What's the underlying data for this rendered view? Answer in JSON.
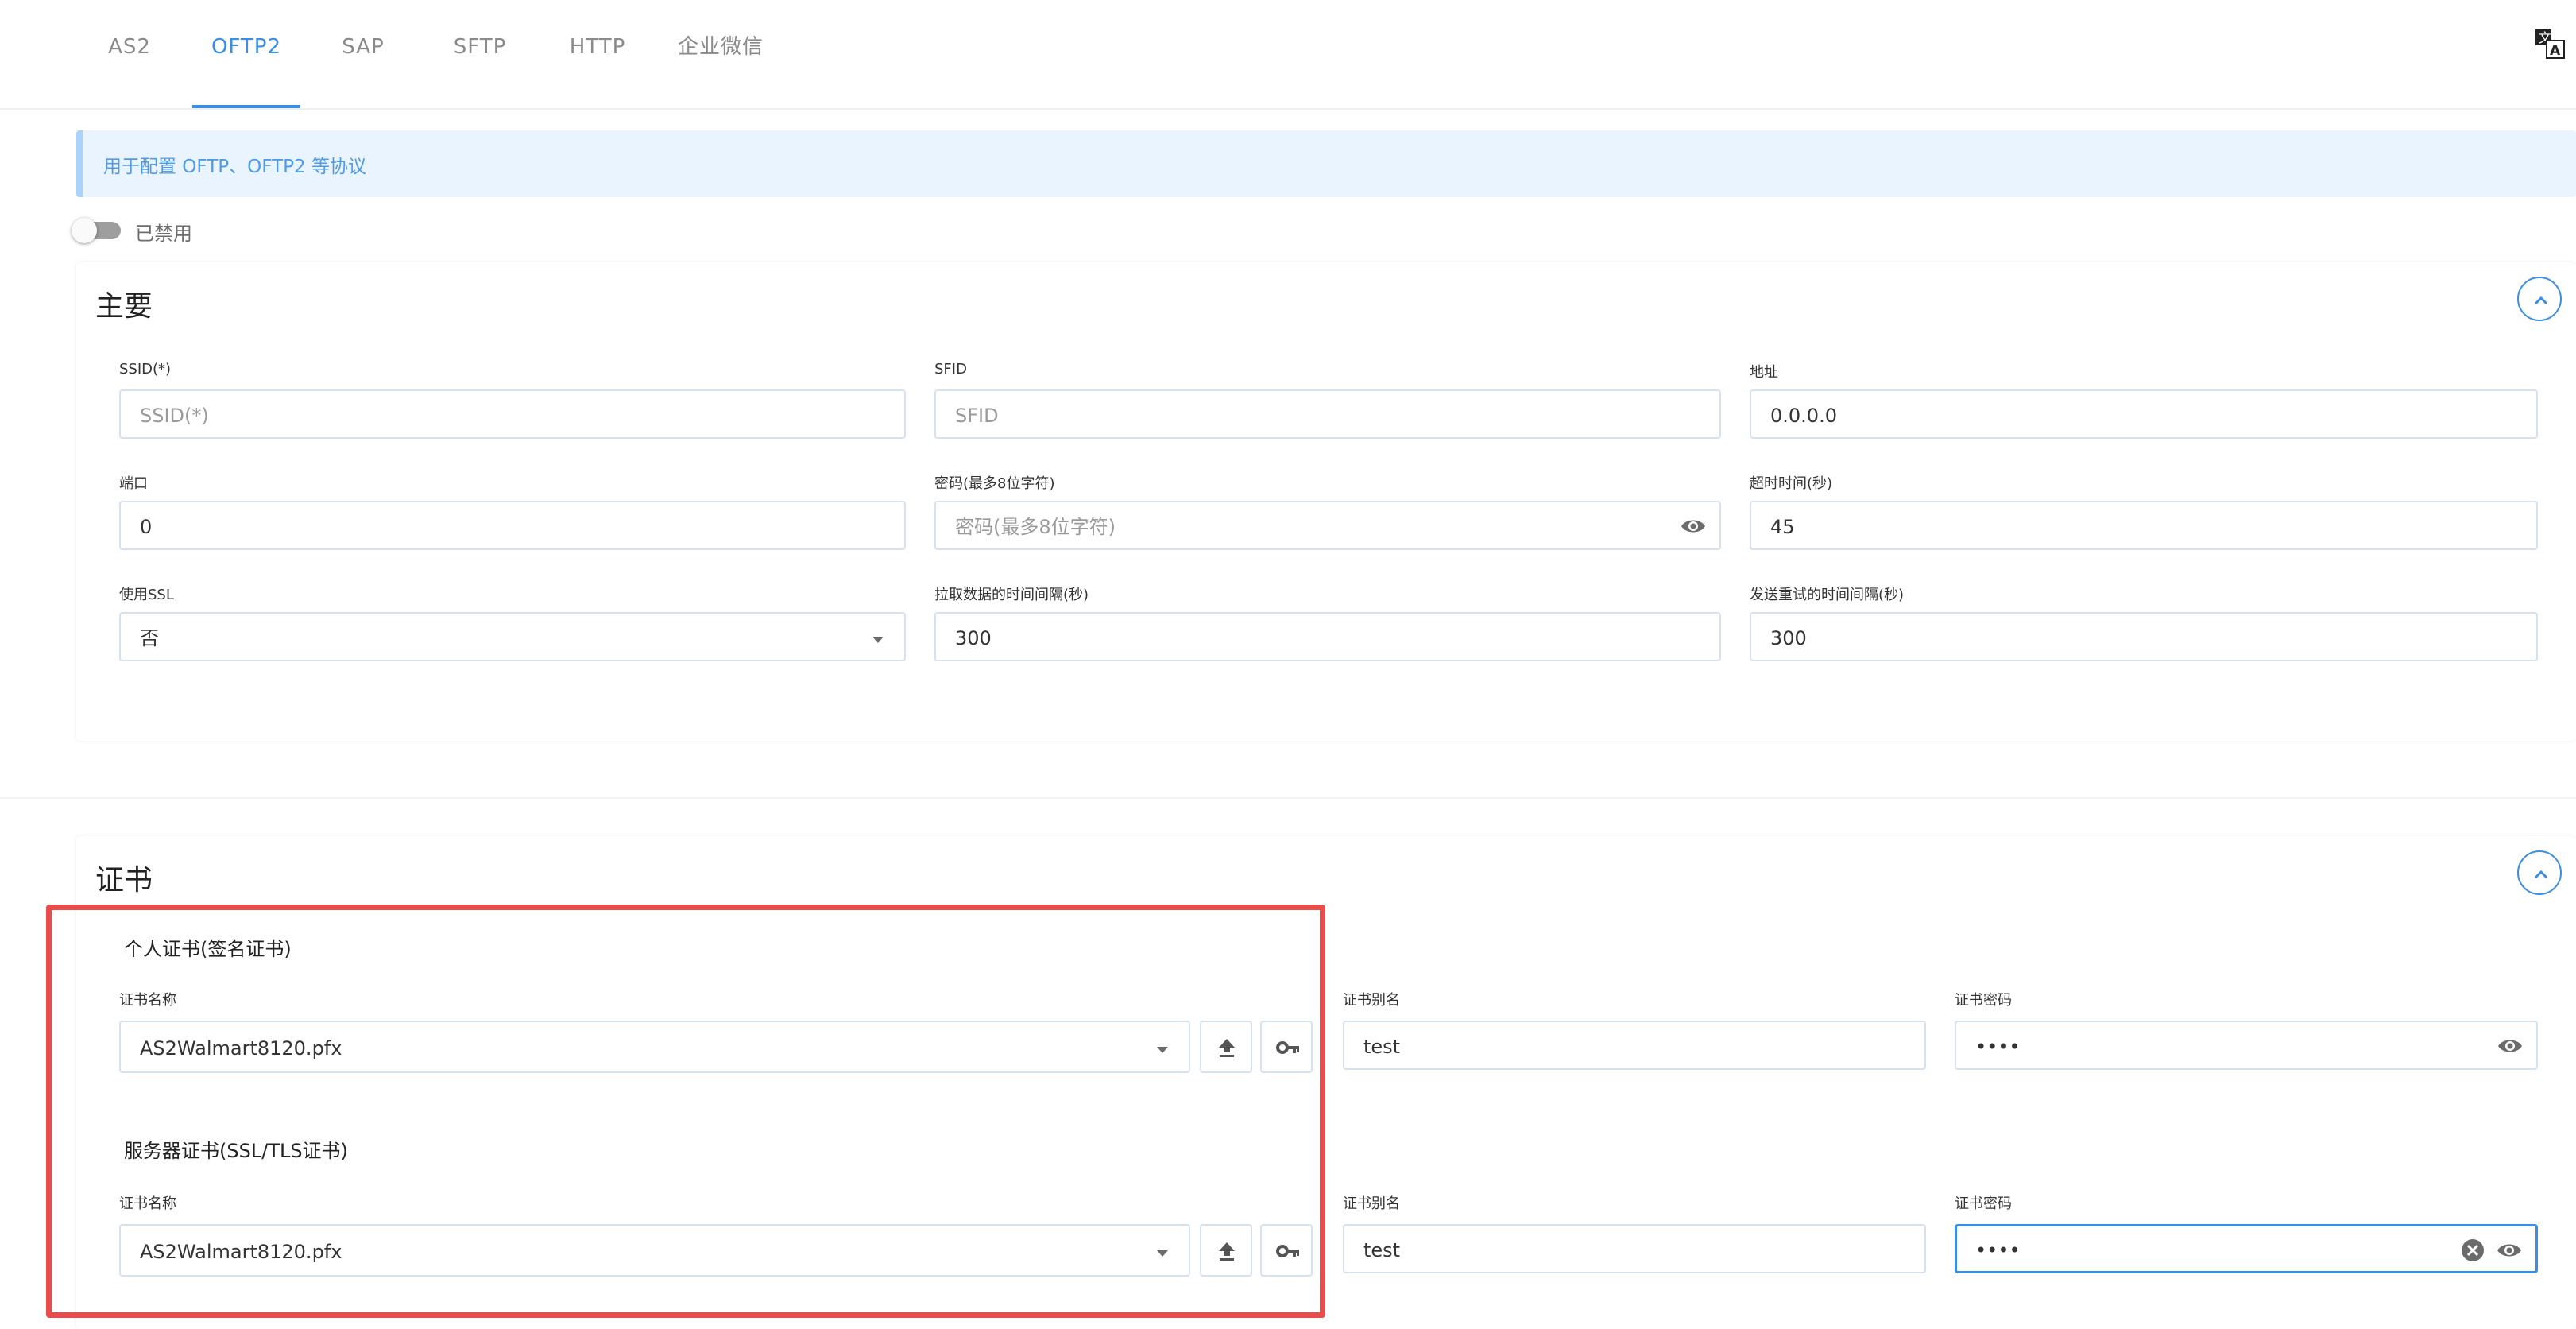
{
  "tabs": [
    {
      "label": "AS2"
    },
    {
      "label": "OFTP2"
    },
    {
      "label": "SAP"
    },
    {
      "label": "SFTP"
    },
    {
      "label": "HTTP"
    },
    {
      "label": "企业微信"
    }
  ],
  "active_tab": "OFTP2",
  "banner": {
    "text": "用于配置 OFTP、OFTP2 等协议"
  },
  "toggle": {
    "label": "已禁用",
    "enabled": false
  },
  "main_section": {
    "title": "主要",
    "fields": {
      "ssid": {
        "label": "SSID(*)",
        "placeholder": "SSID(*)",
        "value": ""
      },
      "sfid": {
        "label": "SFID",
        "placeholder": "SFID",
        "value": ""
      },
      "address": {
        "label": "地址",
        "value": "0.0.0.0"
      },
      "port": {
        "label": "端口",
        "value": "0"
      },
      "password": {
        "label": "密码(最多8位字符)",
        "placeholder": "密码(最多8位字符)",
        "value": ""
      },
      "timeout": {
        "label": "超时时间(秒)",
        "value": "45"
      },
      "use_ssl": {
        "label": "使用SSL",
        "value": "否"
      },
      "fetch_interval": {
        "label": "拉取数据的时间间隔(秒)",
        "value": "300"
      },
      "retry_interval": {
        "label": "发送重试的时间间隔(秒)",
        "value": "300"
      }
    }
  },
  "cert_section": {
    "title": "证书",
    "personal": {
      "heading": "个人证书(签名证书)",
      "name_label": "证书名称",
      "name_value": "AS2Walmart8120.pfx",
      "alias_label": "证书别名",
      "alias_value": "test",
      "password_label": "证书密码",
      "password_value": "••••"
    },
    "server": {
      "heading": "服务器证书(SSL/TLS证书)",
      "name_label": "证书名称",
      "name_value": "AS2Walmart8120.pfx",
      "alias_label": "证书别名",
      "alias_value": "test",
      "password_label": "证书密码",
      "password_value": "••••"
    }
  },
  "colors": {
    "accent": "#3b8ee5",
    "banner_bg": "#eaf4fe",
    "highlight_frame": "#e84d4d"
  }
}
